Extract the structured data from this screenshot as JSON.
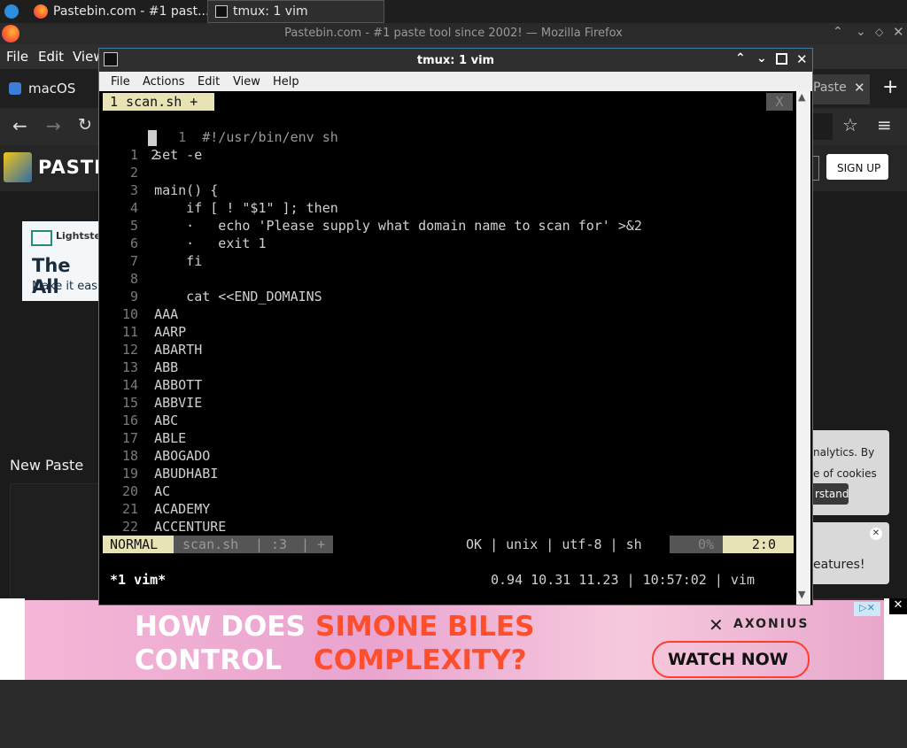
{
  "taskbar": {
    "browser_tab": "Pastebin.com - #1 past...",
    "terminal_tab": "tmux: 1 vim"
  },
  "firefox": {
    "window_title": "Pastebin.com - #1 paste tool since 2002! — Mozilla Firefox",
    "menu": [
      "File",
      "Edit",
      "View"
    ],
    "tab_left": "macOS",
    "tab_right": "Paste",
    "signup": "SIGN UP",
    "logo_text": "PASTE"
  },
  "pastebin": {
    "ad_title_partial": "The All",
    "ad_sub_partial": "Make it eas",
    "ad_brand": "Lightstep",
    "new_paste": "New Paste",
    "cookie_line1": "nalytics. By",
    "cookie_line2": "e of cookies",
    "cookie_btn": "rstand",
    "features": "eatures!"
  },
  "ad": {
    "line1a": "HOW DOES",
    "line1b": "SIMONE BILES",
    "line2a": "CONTROL",
    "line2b": "COMPLEXITY?",
    "brand": "AXONIUS",
    "cta": "WATCH NOW"
  },
  "terminal": {
    "title": "tmux: 1 vim",
    "menu": [
      "File",
      "Actions",
      "Edit",
      "View",
      "Help"
    ],
    "vim_tab": "1 scan.sh +",
    "vim_tab_close": "X",
    "header_line_num": "1",
    "header_line": "#!/usr/bin/env sh",
    "cursor_line_num": "2",
    "lines": [
      {
        "n": "1",
        "t": "set -e"
      },
      {
        "n": "2",
        "t": ""
      },
      {
        "n": "3",
        "t": "main() {"
      },
      {
        "n": "4",
        "t": "    if [ ! \"$1\" ]; then"
      },
      {
        "n": "5",
        "t": "    ·   echo 'Please supply what domain name to scan for' >&2"
      },
      {
        "n": "6",
        "t": "    ·   exit 1"
      },
      {
        "n": "7",
        "t": "    fi"
      },
      {
        "n": "8",
        "t": ""
      },
      {
        "n": "9",
        "t": "    cat <<END_DOMAINS"
      },
      {
        "n": "10",
        "t": "AAA"
      },
      {
        "n": "11",
        "t": "AARP"
      },
      {
        "n": "12",
        "t": "ABARTH"
      },
      {
        "n": "13",
        "t": "ABB"
      },
      {
        "n": "14",
        "t": "ABBOTT"
      },
      {
        "n": "15",
        "t": "ABBVIE"
      },
      {
        "n": "16",
        "t": "ABC"
      },
      {
        "n": "17",
        "t": "ABLE"
      },
      {
        "n": "18",
        "t": "ABOGADO"
      },
      {
        "n": "19",
        "t": "ABUDHABI"
      },
      {
        "n": "20",
        "t": "AC"
      },
      {
        "n": "21",
        "t": "ACADEMY"
      },
      {
        "n": "22",
        "t": "ACCENTURE"
      }
    ],
    "status": {
      "mode": "NORMAL",
      "file": "scan.sh",
      "sep1": "|",
      "line_info": ":3",
      "sep2": "|",
      "modified": "+",
      "right": "OK | unix | utf-8 | sh",
      "percent": "0%",
      "position": "2:0"
    },
    "tmux": {
      "window": "*1 vim*",
      "right": "0.94 10.31 11.23 | 10:57:02 | vim"
    }
  }
}
